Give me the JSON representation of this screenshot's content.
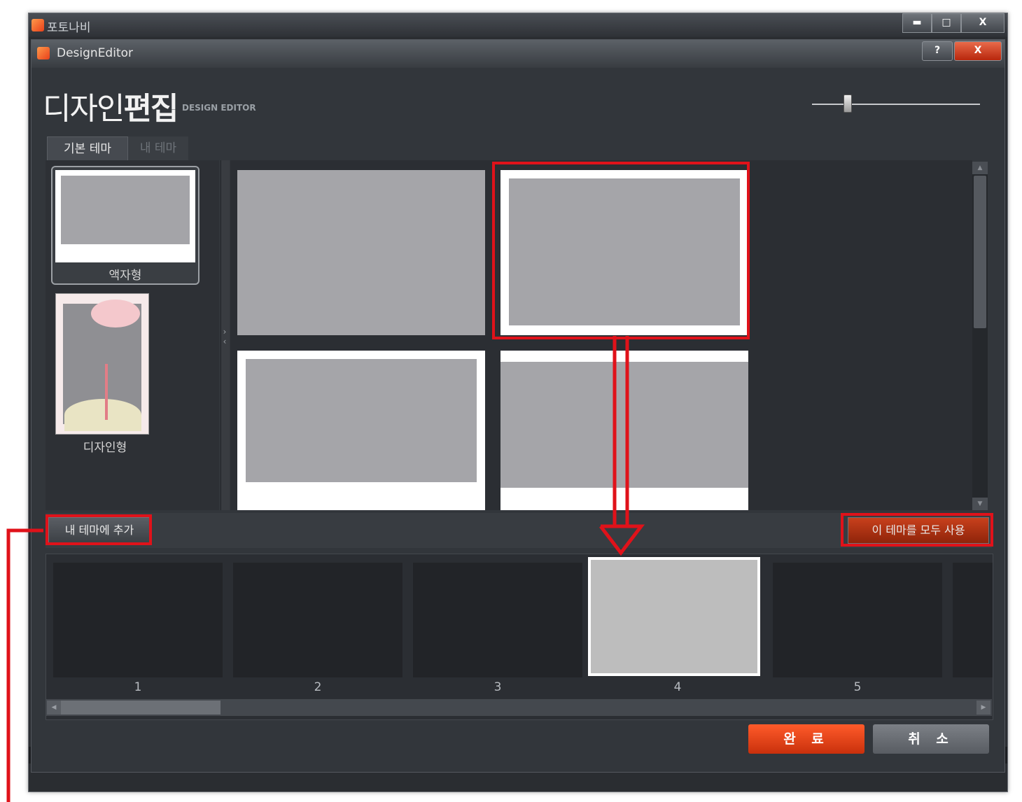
{
  "outer_window": {
    "title": "포토나비",
    "controls": {
      "minimize": "▬",
      "maximize": "□",
      "close": "X"
    }
  },
  "dialog": {
    "title": "DesignEditor",
    "controls": {
      "help": "?",
      "close": "X"
    }
  },
  "header": {
    "title_light": "디자인",
    "title_bold": "편집",
    "subtitle": "DESIGN EDITOR"
  },
  "tabs": [
    {
      "label": "기본 테마",
      "active": true
    },
    {
      "label": "내 테마",
      "active": false
    }
  ],
  "themes": [
    {
      "label": "액자형",
      "selected": true
    },
    {
      "label": "디자인형",
      "selected": false
    }
  ],
  "actions": {
    "add_to_my_theme": "내 테마에 추가",
    "use_all_theme": "이 테마를 모두 사용"
  },
  "pages": [
    {
      "number": "1",
      "selected": false
    },
    {
      "number": "2",
      "selected": false
    },
    {
      "number": "3",
      "selected": false
    },
    {
      "number": "4",
      "selected": true
    },
    {
      "number": "5",
      "selected": false
    }
  ],
  "footer": {
    "ok": "완 료",
    "cancel": "취 소"
  },
  "colors": {
    "accent_orange": "#e8401a",
    "annotation_red": "#e0121a",
    "placeholder_gray": "#a5a5a9"
  }
}
